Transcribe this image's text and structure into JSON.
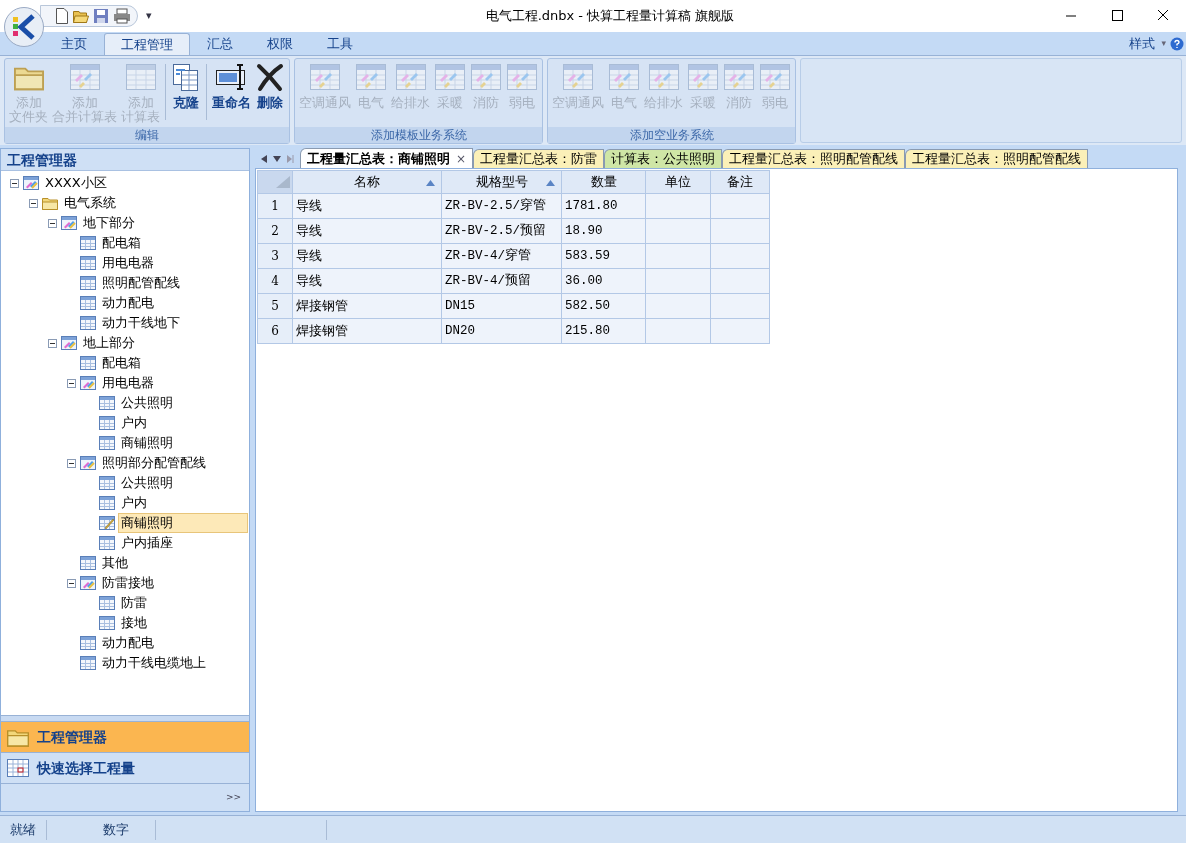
{
  "window": {
    "title": "电气工程.dnbx - 快算工程量计算稿 旗舰版"
  },
  "quick_access": {
    "more": "▾"
  },
  "menu_tabs": [
    {
      "label": "主页",
      "selected": false
    },
    {
      "label": "工程管理",
      "selected": true
    },
    {
      "label": "汇总",
      "selected": false
    },
    {
      "label": "权限",
      "selected": false
    },
    {
      "label": "工具",
      "selected": false
    }
  ],
  "style_menu": {
    "label": "样式",
    "caret": "▾"
  },
  "ribbon_groups": [
    {
      "label": "编辑",
      "buttons": [
        {
          "kind": "folder",
          "lines": [
            "添加",
            "文件夹"
          ],
          "disabled": true
        },
        {
          "kind": "sheet-pen",
          "lines": [
            "添加",
            "合并计算表"
          ],
          "disabled": true
        },
        {
          "kind": "sheet",
          "lines": [
            "添加",
            "计算表"
          ],
          "disabled": true
        },
        {
          "kind": "clone",
          "lines": [
            "克隆"
          ],
          "disabled": false
        },
        {
          "kind": "rename",
          "lines": [
            "重命名"
          ],
          "disabled": false
        },
        {
          "kind": "delete",
          "lines": [
            "删除"
          ],
          "disabled": false
        }
      ]
    },
    {
      "label": "添加模板业务系统",
      "buttons": [
        {
          "kind": "sheet-pen",
          "lines": [
            "空调通风"
          ],
          "disabled": true
        },
        {
          "kind": "sheet-pen",
          "lines": [
            "电气"
          ],
          "disabled": true
        },
        {
          "kind": "sheet-pen",
          "lines": [
            "给排水"
          ],
          "disabled": true
        },
        {
          "kind": "sheet-pen",
          "lines": [
            "采暖"
          ],
          "disabled": true
        },
        {
          "kind": "sheet-pen",
          "lines": [
            "消防"
          ],
          "disabled": true
        },
        {
          "kind": "sheet-pen",
          "lines": [
            "弱电"
          ],
          "disabled": true
        }
      ]
    },
    {
      "label": "添加空业务系统",
      "buttons": [
        {
          "kind": "sheet-pen",
          "lines": [
            "空调通风"
          ],
          "disabled": true
        },
        {
          "kind": "sheet-pen",
          "lines": [
            "电气"
          ],
          "disabled": true
        },
        {
          "kind": "sheet-pen",
          "lines": [
            "给排水"
          ],
          "disabled": true
        },
        {
          "kind": "sheet-pen",
          "lines": [
            "采暖"
          ],
          "disabled": true
        },
        {
          "kind": "sheet-pen",
          "lines": [
            "消防"
          ],
          "disabled": true
        },
        {
          "kind": "sheet-pen",
          "lines": [
            "弱电"
          ],
          "disabled": true
        }
      ]
    }
  ],
  "project_panel": {
    "title": "工程管理器",
    "tree": [
      {
        "label": "XXXX小区",
        "kind": "project",
        "expanded": true,
        "selected": false,
        "children": [
          {
            "label": "电气系统",
            "kind": "folder",
            "expanded": true,
            "selected": false,
            "children": [
              {
                "label": "地下部分",
                "kind": "group",
                "expanded": true,
                "selected": false,
                "children": [
                  {
                    "label": "配电箱",
                    "kind": "sheet",
                    "selected": false
                  },
                  {
                    "label": "用电电器",
                    "kind": "sheet",
                    "selected": false
                  },
                  {
                    "label": "照明配管配线",
                    "kind": "sheet",
                    "selected": false
                  },
                  {
                    "label": "动力配电",
                    "kind": "sheet",
                    "selected": false
                  },
                  {
                    "label": "动力干线地下",
                    "kind": "sheet",
                    "selected": false
                  }
                ]
              },
              {
                "label": "地上部分",
                "kind": "group",
                "expanded": true,
                "selected": false,
                "children": [
                  {
                    "label": "配电箱",
                    "kind": "sheet",
                    "selected": false
                  },
                  {
                    "label": "用电电器",
                    "kind": "group",
                    "expanded": true,
                    "selected": false,
                    "children": [
                      {
                        "label": "公共照明",
                        "kind": "sheet",
                        "selected": false
                      },
                      {
                        "label": "户内",
                        "kind": "sheet",
                        "selected": false
                      },
                      {
                        "label": "商铺照明",
                        "kind": "sheet",
                        "selected": false
                      }
                    ]
                  },
                  {
                    "label": "照明部分配管配线",
                    "kind": "group",
                    "expanded": true,
                    "selected": false,
                    "children": [
                      {
                        "label": "公共照明",
                        "kind": "sheet",
                        "selected": false
                      },
                      {
                        "label": "户内",
                        "kind": "sheet",
                        "selected": false
                      },
                      {
                        "label": "商铺照明",
                        "kind": "edit",
                        "selected": true
                      },
                      {
                        "label": "户内插座",
                        "kind": "sheet",
                        "selected": false
                      }
                    ]
                  },
                  {
                    "label": "其他",
                    "kind": "sheet",
                    "selected": false
                  },
                  {
                    "label": "防雷接地",
                    "kind": "group",
                    "expanded": true,
                    "selected": false,
                    "children": [
                      {
                        "label": "防雷",
                        "kind": "sheet",
                        "selected": false
                      },
                      {
                        "label": "接地",
                        "kind": "sheet",
                        "selected": false
                      }
                    ]
                  },
                  {
                    "label": "动力配电",
                    "kind": "sheet",
                    "selected": false
                  },
                  {
                    "label": "动力干线电缆地上",
                    "kind": "sheet",
                    "selected": false
                  }
                ]
              }
            ]
          }
        ]
      }
    ]
  },
  "nav_items": [
    {
      "label": "工程管理器",
      "kind": "folder",
      "selected": true
    },
    {
      "label": "快速选择工程量",
      "kind": "calendar",
      "selected": false
    }
  ],
  "nav_more": ">>",
  "doc_tabs": [
    {
      "label": "工程量汇总表：商铺照明",
      "selected": true,
      "color": "#ffffff",
      "close": "×"
    },
    {
      "label": "工程量汇总表：防雷",
      "selected": false,
      "color": "#fbf0b8"
    },
    {
      "label": "计算表：公共照明",
      "selected": false,
      "color": "#cfe6a6"
    },
    {
      "label": "工程量汇总表：照明配管配线",
      "selected": false,
      "color": "#fbf0b8"
    },
    {
      "label": "工程量汇总表：照明配管配线",
      "selected": false,
      "color": "#fbf0b8"
    }
  ],
  "table": {
    "columns": [
      {
        "label": "名称",
        "sorted": true
      },
      {
        "label": "规格型号",
        "sorted": true
      },
      {
        "label": "数量",
        "sorted": false
      },
      {
        "label": "单位",
        "sorted": false
      },
      {
        "label": "备注",
        "sorted": false
      }
    ],
    "rows": [
      {
        "number": "1",
        "cells": [
          "导线",
          "ZR-BV-2.5/穿管",
          "1781.80"
        ]
      },
      {
        "number": "2",
        "cells": [
          "导线",
          "ZR-BV-2.5/预留",
          "18.90"
        ]
      },
      {
        "number": "3",
        "cells": [
          "导线",
          "ZR-BV-4/穿管",
          "583.59"
        ]
      },
      {
        "number": "4",
        "cells": [
          "导线",
          "ZR-BV-4/预留",
          "36.00"
        ]
      },
      {
        "number": "5",
        "cells": [
          "焊接钢管",
          "DN15",
          "582.50"
        ]
      },
      {
        "number": "6",
        "cells": [
          "焊接钢管",
          "DN20",
          "215.80"
        ]
      }
    ]
  },
  "status_bar": [
    "就绪",
    "数字"
  ]
}
